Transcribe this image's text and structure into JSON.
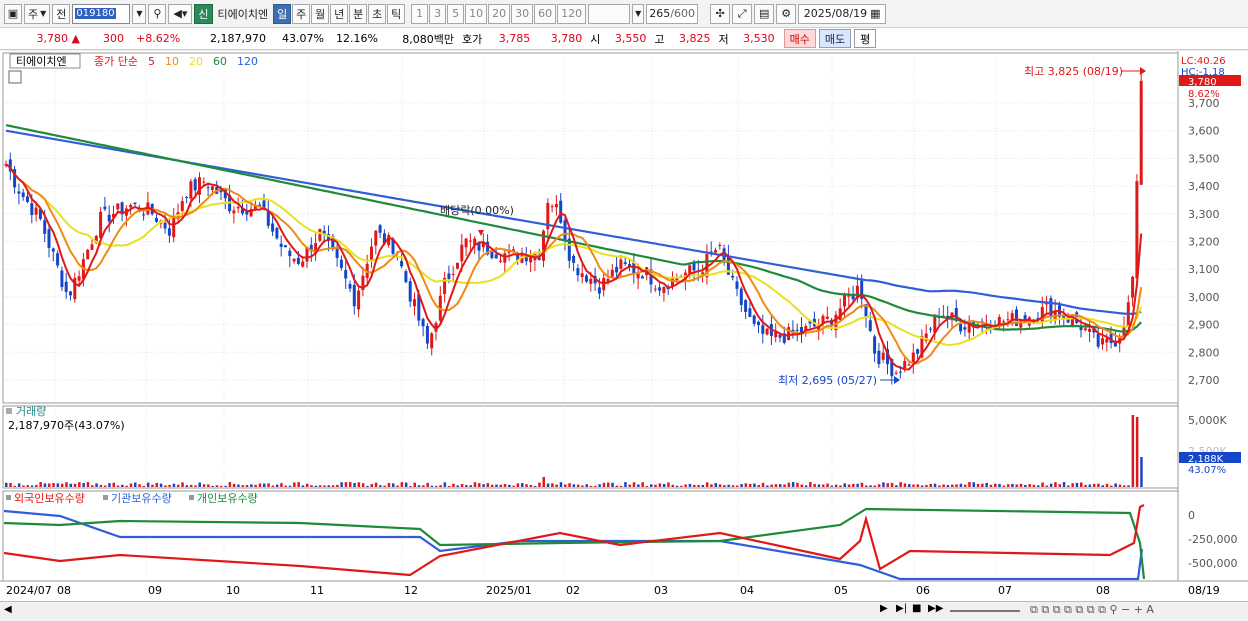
{
  "toolbar": {
    "type_select": "주",
    "prev_label": "전",
    "code": "019180",
    "badge": "신",
    "name": "티에이치엔",
    "periods": [
      "일",
      "주",
      "월",
      "년",
      "분",
      "초",
      "틱"
    ],
    "minutes": [
      "1",
      "3",
      "5",
      "10",
      "20",
      "30",
      "60",
      "120"
    ],
    "count": "265",
    "count_total": "/600",
    "date": "2025/08/19"
  },
  "quote": {
    "price": "3,780",
    "arrow": "▲",
    "change": "300",
    "rate": "+8.62%",
    "volume": "2,187,970",
    "vol_rate": "43.07%",
    "turnover": "12.16%",
    "amount": "8,080백만",
    "bid_label": "호가",
    "bid": "3,785",
    "ask": "3,780",
    "open_label": "시",
    "open": "3,550",
    "high_label": "고",
    "high": "3,825",
    "low_label": "저",
    "low": "3,530",
    "buy": "매수",
    "sell": "매도",
    "avg": "평"
  },
  "main_panel": {
    "stock_tag": "티에이치엔",
    "ma_title": "종가 단순",
    "ma_periods": [
      {
        "label": "5",
        "color": "#e01818"
      },
      {
        "label": "10",
        "color": "#f08a12"
      },
      {
        "label": "20",
        "color": "#e8e020"
      },
      {
        "label": "60",
        "color": "#1f8a3a"
      },
      {
        "label": "120",
        "color": "#2f5fd8"
      }
    ],
    "lc_label": "LC:40.26",
    "hc_label": "HC:-1.18",
    "last_price_tag": "3,780",
    "last_rate_tag": "8.62%",
    "y_ticks": [
      "3,700",
      "3,600",
      "3,500",
      "3,400",
      "3,300",
      "3,200",
      "3,100",
      "3,000",
      "2,900",
      "2,800",
      "2,700"
    ],
    "high_annot": "최고 3,825 (08/19)",
    "low_annot": "최저 2,695 (05/27)",
    "dividend_annot": "배당락(0.00%)"
  },
  "volume_panel": {
    "title": "거래량",
    "value": "2,187,970주(43.07%)",
    "y_ticks": [
      "5,000K",
      "2,500K"
    ],
    "last_tag": "2,188K",
    "last_rate": "43.07%"
  },
  "holding_panel": {
    "legend": [
      {
        "label": "외국인보유수량",
        "color": "#e01818"
      },
      {
        "label": "기관보유수량",
        "color": "#2f5fd8"
      },
      {
        "label": "개인보유수량",
        "color": "#1f8a3a"
      }
    ],
    "y_ticks": [
      "0",
      "-250,000",
      "-500,000"
    ]
  },
  "x_axis": {
    "labels": [
      "2024/07",
      "08",
      "09",
      "10",
      "11",
      "12",
      "2025/01",
      "02",
      "03",
      "04",
      "05",
      "06",
      "07",
      "08"
    ],
    "last_date": "08/19"
  },
  "colors": {
    "up": "#e01818",
    "down": "#1646c8",
    "ma5": "#e01818",
    "ma10": "#f08a12",
    "ma20": "#e8e020",
    "ma60": "#1f8a3a",
    "ma120": "#2f5fd8"
  }
}
